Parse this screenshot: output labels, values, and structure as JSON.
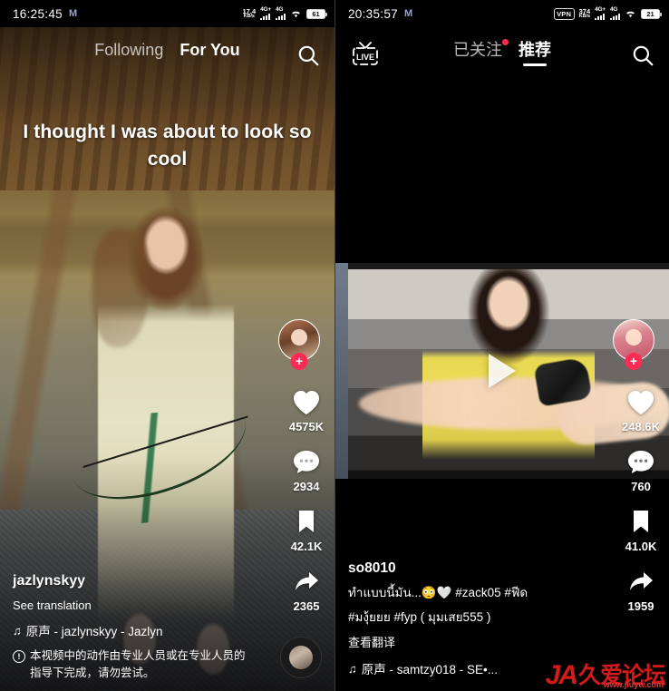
{
  "left_panel": {
    "statusbar": {
      "time": "16:25:45",
      "m_label": "M",
      "net_speed_value": "17.4",
      "net_speed_unit": "KB/s",
      "sig1": "4G+",
      "sig2": "4G",
      "battery": "61",
      "wifi_icon": "wifi-icon",
      "signal_icon": "signal-bars-icon"
    },
    "topnav": {
      "tab_following": "Following",
      "tab_foryou": "For You",
      "search_icon": "search-icon"
    },
    "video_caption": "I thought I was about to look so cool",
    "rail": {
      "avatar_icon": "avatar",
      "follow_plus": "+",
      "like_icon": "heart-icon",
      "like_count": "4575K",
      "comment_icon": "comment-icon",
      "comment_count": "2934",
      "bookmark_icon": "bookmark-icon",
      "bookmark_count": "42.1K",
      "share_icon": "share-icon",
      "share_count": "2365",
      "music_disc_icon": "music-disc-icon"
    },
    "info": {
      "username": "jazlynskyy",
      "see_translation": "See translation",
      "music_note": "♫",
      "music_text": "原声 - jazlynskyy - Jazlyn",
      "warning_mark": "!",
      "warning_text": "本视频中的动作由专业人员或在专业人员的指导下完成，请勿尝试。"
    }
  },
  "right_panel": {
    "statusbar": {
      "time": "20:35:57",
      "m_label": "M",
      "vpn": "VPN",
      "net_speed_value": "374",
      "net_speed_unit": "KB/s",
      "sig1": "4G+",
      "sig2": "4G",
      "battery": "21",
      "wifi_icon": "wifi-icon",
      "signal_icon": "signal-bars-icon"
    },
    "topnav": {
      "live_icon": "live-icon",
      "live_label": "LIVE",
      "tab_following": "已关注",
      "tab_recommend": "推荐",
      "search_icon": "search-icon"
    },
    "player": {
      "play_icon": "play-icon"
    },
    "rail": {
      "avatar_icon": "avatar",
      "follow_plus": "+",
      "like_icon": "heart-icon",
      "like_count": "248.6K",
      "comment_icon": "comment-icon",
      "comment_count": "760",
      "bookmark_icon": "bookmark-icon",
      "bookmark_count": "41.0K",
      "share_icon": "share-icon",
      "share_count": "1959"
    },
    "info": {
      "username": "so8010",
      "desc_line1": "ทำแบบนี้มัน...😳🤍 #zack05 #ฟีด",
      "desc_line2": "#มงุ้ยยย #fyp ( มุมเสย555 )",
      "see_translation": "查看翻译",
      "music_note": "♫",
      "music_text": "原声 - samtzy018 - SE•..."
    },
    "watermark": {
      "logo": "JA",
      "name": "久爱论坛",
      "url": "www.jiuyw.com",
      "color": "#d51a1a"
    }
  }
}
